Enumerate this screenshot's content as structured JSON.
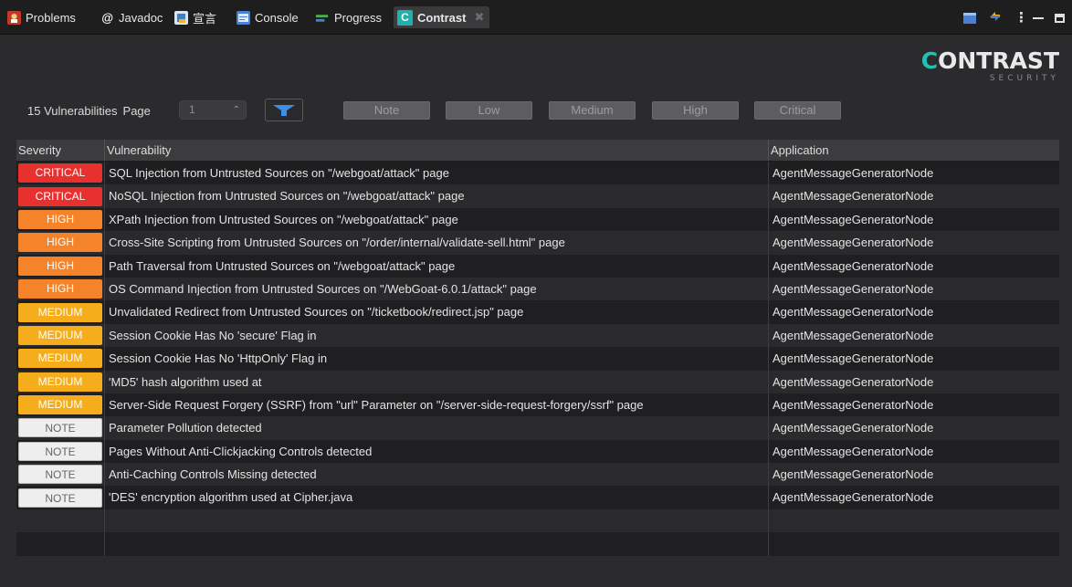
{
  "tabs": [
    {
      "label": "Problems",
      "icon": "problems-icon",
      "color": "#c0392b"
    },
    {
      "label": "Javadoc",
      "icon": "javadoc-icon",
      "color": "#2b2b2d"
    },
    {
      "label": "宣言",
      "icon": "declaration-icon",
      "color": "#3f7fbf"
    },
    {
      "label": "Console",
      "icon": "console-icon",
      "color": "#4a7fd4"
    },
    {
      "label": "Progress",
      "icon": "progress-icon",
      "color": "#4caf50"
    },
    {
      "label": "Contrast",
      "icon": "contrast-icon",
      "color": "#20b2aa"
    }
  ],
  "logo": {
    "word": "CONTRAST",
    "sub": "SECURITY",
    "accent": "#20c2b6"
  },
  "toolbar": {
    "count": "15 Vulnerabilities",
    "page_label": "Page",
    "page_value": "1",
    "filters": [
      "Note",
      "Low",
      "Medium",
      "High",
      "Critical"
    ]
  },
  "table": {
    "headers": [
      "Severity",
      "Vulnerability",
      "Application"
    ],
    "severity_colors": {
      "CRITICAL": "#e8302e",
      "HIGH": "#f5832a",
      "MEDIUM": "#f6ad1b",
      "NOTE": "#eeeeee"
    },
    "rows": [
      {
        "severity": "CRITICAL",
        "vulnerability": "SQL Injection from Untrusted Sources on \"/webgoat/attack\" page",
        "application": "AgentMessageGeneratorNode"
      },
      {
        "severity": "CRITICAL",
        "vulnerability": "NoSQL Injection from Untrusted Sources on \"/webgoat/attack\" page",
        "application": "AgentMessageGeneratorNode"
      },
      {
        "severity": "HIGH",
        "vulnerability": "XPath Injection from Untrusted Sources on \"/webgoat/attack\" page",
        "application": "AgentMessageGeneratorNode"
      },
      {
        "severity": "HIGH",
        "vulnerability": "Cross-Site Scripting from Untrusted Sources on \"/order/internal/validate-sell.html\" page",
        "application": "AgentMessageGeneratorNode"
      },
      {
        "severity": "HIGH",
        "vulnerability": "Path Traversal from Untrusted Sources on \"/webgoat/attack\" page",
        "application": "AgentMessageGeneratorNode"
      },
      {
        "severity": "HIGH",
        "vulnerability": "OS Command Injection from Untrusted Sources on \"/WebGoat-6.0.1/attack\" page",
        "application": "AgentMessageGeneratorNode"
      },
      {
        "severity": "MEDIUM",
        "vulnerability": "Unvalidated Redirect from Untrusted Sources on \"/ticketbook/redirect.jsp\" page",
        "application": "AgentMessageGeneratorNode"
      },
      {
        "severity": "MEDIUM",
        "vulnerability": "Session Cookie Has No 'secure' Flag  in",
        "application": "AgentMessageGeneratorNode"
      },
      {
        "severity": "MEDIUM",
        "vulnerability": "Session Cookie Has No 'HttpOnly' Flag  in",
        "application": "AgentMessageGeneratorNode"
      },
      {
        "severity": "MEDIUM",
        "vulnerability": "'MD5' hash algorithm used at",
        "application": "AgentMessageGeneratorNode"
      },
      {
        "severity": "MEDIUM",
        "vulnerability": "Server-Side Request Forgery (SSRF) from \"url\" Parameter on \"/server-side-request-forgery/ssrf\" page",
        "application": "AgentMessageGeneratorNode"
      },
      {
        "severity": "NOTE",
        "vulnerability": "Parameter Pollution detected",
        "application": "AgentMessageGeneratorNode"
      },
      {
        "severity": "NOTE",
        "vulnerability": "Pages Without Anti-Clickjacking Controls detected",
        "application": "AgentMessageGeneratorNode"
      },
      {
        "severity": "NOTE",
        "vulnerability": "Anti-Caching Controls Missing detected",
        "application": "AgentMessageGeneratorNode"
      },
      {
        "severity": "NOTE",
        "vulnerability": "'DES' encryption algorithm used at Cipher.java",
        "application": "AgentMessageGeneratorNode"
      }
    ]
  }
}
